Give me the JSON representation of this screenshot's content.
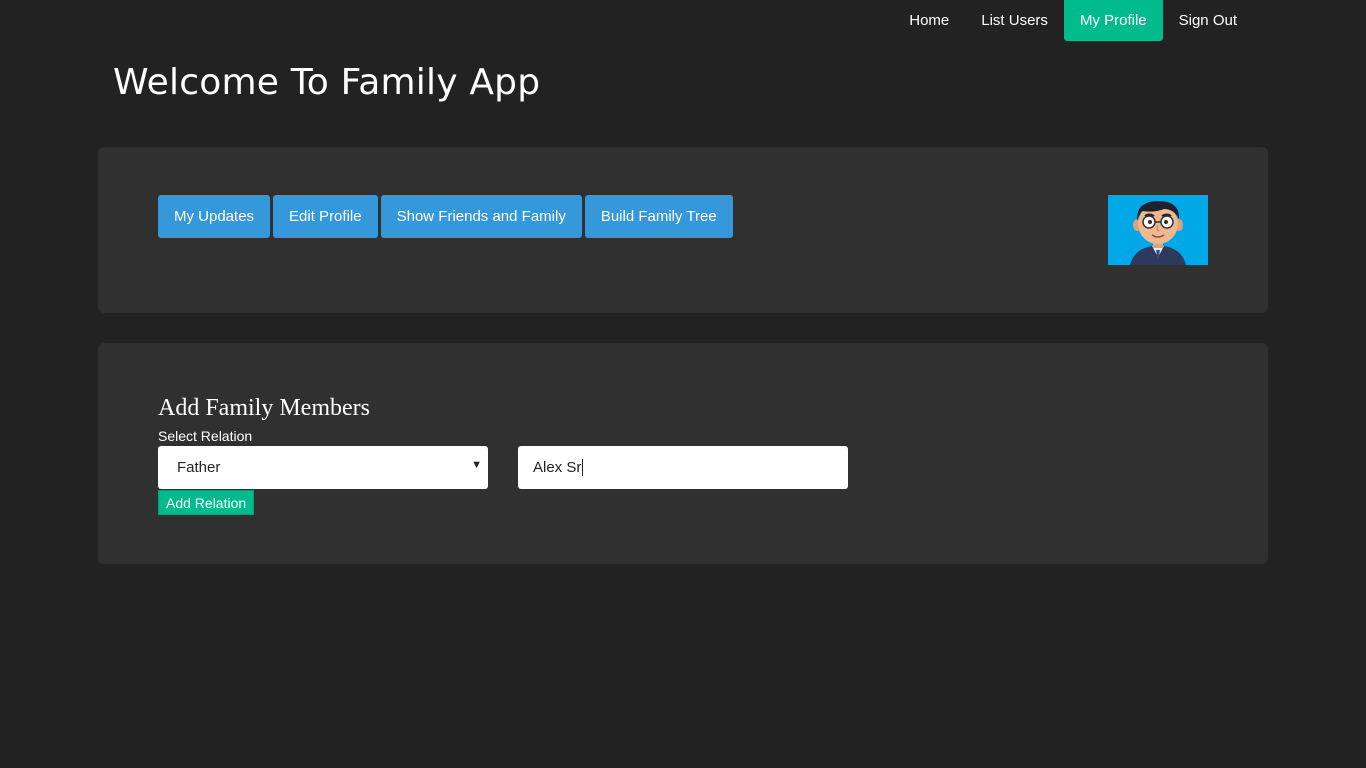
{
  "nav": {
    "items": [
      {
        "label": "Home"
      },
      {
        "label": "List Users"
      },
      {
        "label": "My Profile"
      },
      {
        "label": "Sign Out"
      }
    ],
    "active_color": "#00bc8c"
  },
  "page": {
    "title": "Welcome To Family App"
  },
  "profile": {
    "buttons": [
      {
        "label": "My Updates"
      },
      {
        "label": "Edit Profile"
      },
      {
        "label": "Show Friends and Family"
      },
      {
        "label": "Build Family Tree"
      }
    ],
    "avatar_icon": "cartoon-man-avatar"
  },
  "family": {
    "title": "Add Family Members",
    "relation_label": "Select Relation",
    "relation_selected": "Father",
    "name_value": "Alex Sr",
    "add_button": "Add Relation"
  },
  "colors": {
    "background": "#222222",
    "panel": "#303030",
    "primary": "#3498db",
    "success": "#00bc8c"
  }
}
